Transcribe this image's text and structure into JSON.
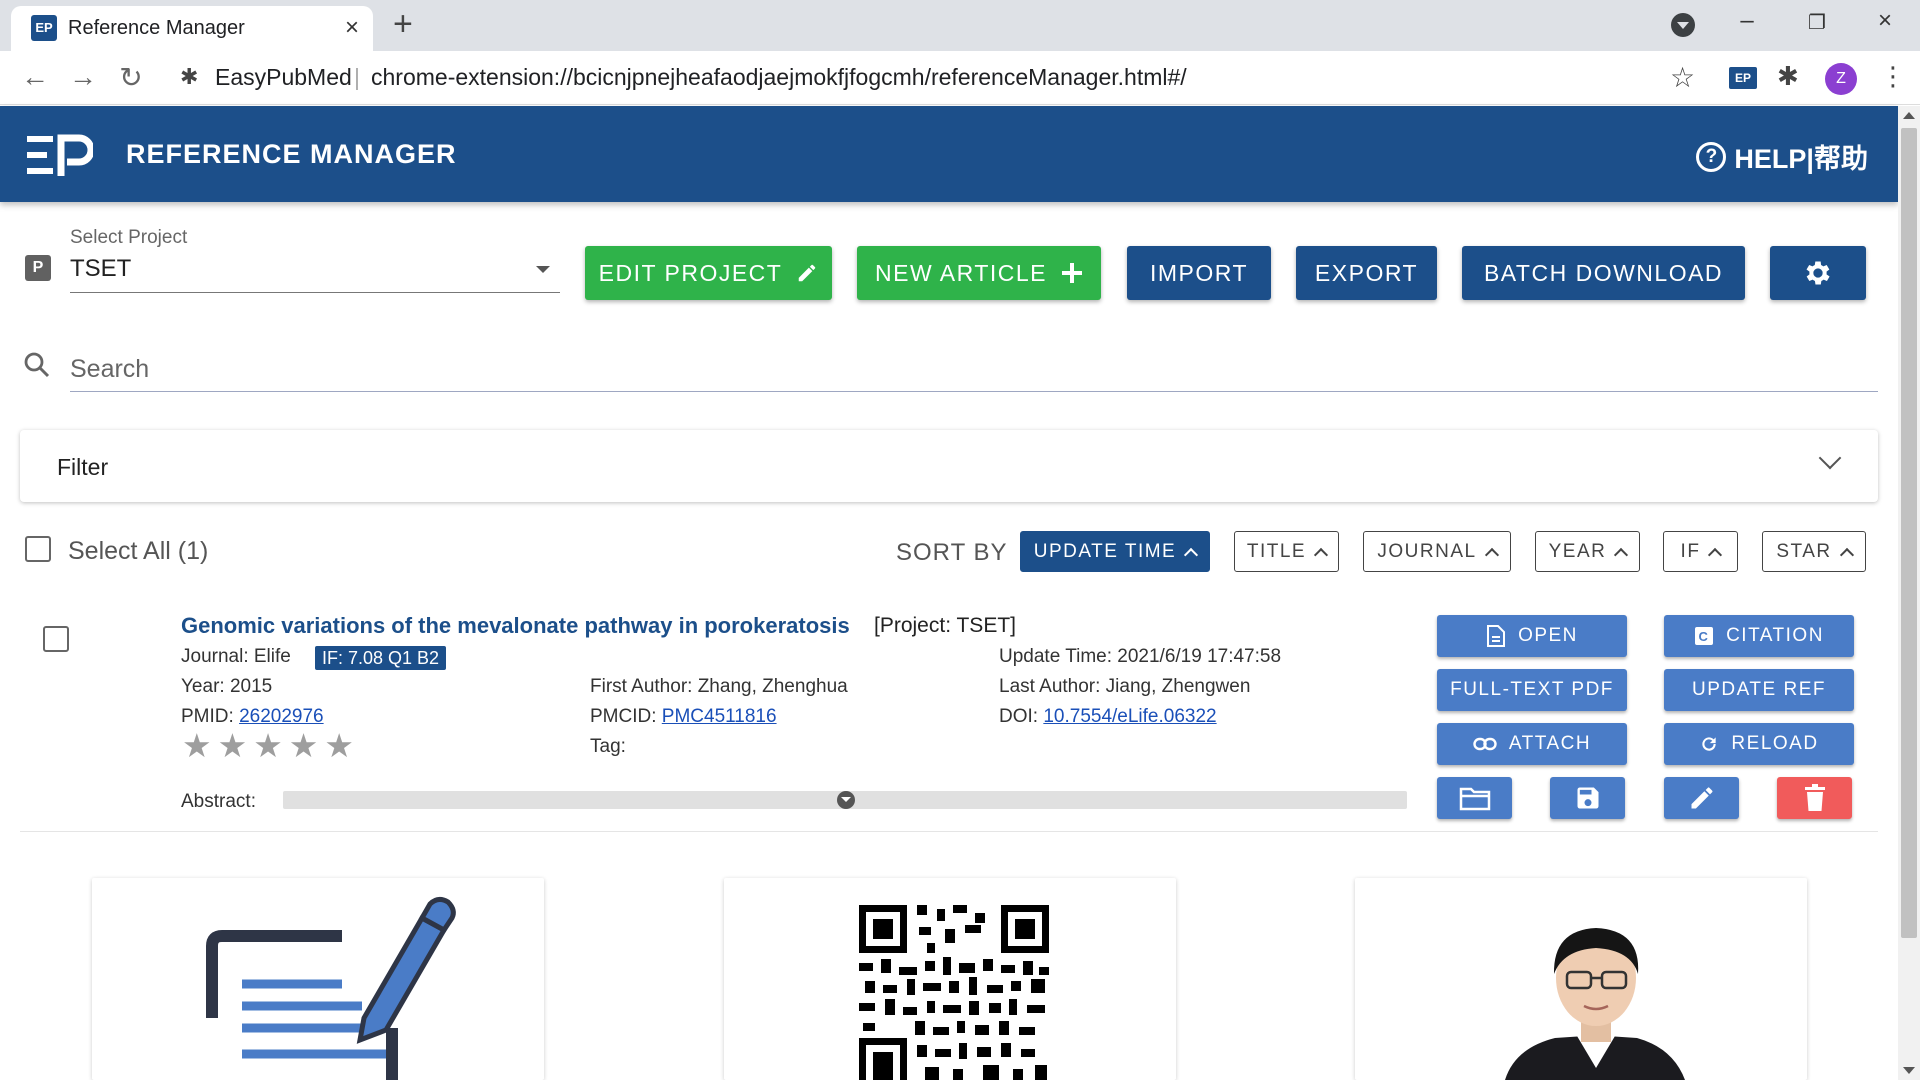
{
  "browser": {
    "tab_title": "Reference Manager",
    "tab_favicon": "EP",
    "tab_close": "×",
    "new_tab": "+",
    "window_minimize": "–",
    "window_restore": "❐",
    "window_close": "×",
    "back": "←",
    "forward": "→",
    "reload": "↻",
    "extension_name": "EasyPubMed",
    "separator": "|",
    "url": "chrome-extension://bcicnjpnejheafaodjaejmokfjfogcmh/referenceManager.html#/",
    "bookmark_star": "☆",
    "ext_badge": "EP",
    "profile_initial": "Z",
    "menu": "⋮"
  },
  "header": {
    "title": "REFERENCE MANAGER",
    "help_label": "HELP|帮助",
    "help_icon_glyph": "?"
  },
  "project": {
    "icon_letter": "P",
    "select_label": "Select Project",
    "selected": "TSET"
  },
  "actions": {
    "edit_project": "EDIT PROJECT",
    "new_article": "NEW ARTICLE",
    "import": "IMPORT",
    "export": "EXPORT",
    "batch_download": "BATCH DOWNLOAD"
  },
  "search": {
    "placeholder": "Search"
  },
  "filter": {
    "label": "Filter"
  },
  "list": {
    "select_all": "Select All (1)",
    "sort_by": "SORT BY",
    "sort_options": [
      "UPDATE TIME",
      "TITLE",
      "JOURNAL",
      "YEAR",
      "IF",
      "STAR"
    ],
    "active_sort": "UPDATE TIME"
  },
  "article": {
    "title": "Genomic variations of the mevalonate pathway in porokeratosis",
    "project_tag": "[Project: TSET]",
    "journal": "Journal: Elife",
    "if_badge": "IF: 7.08 Q1 B2",
    "year": "Year: 2015",
    "pmid_label": "PMID: ",
    "pmid": "26202976",
    "first_author": "First Author: Zhang, Zhenghua",
    "pmcid_label": "PMCID: ",
    "pmcid": "PMC4511816",
    "tag_label": "Tag:",
    "update_time": "Update Time: 2021/6/19 17:47:58",
    "last_author": "Last Author: Jiang, Zhengwen",
    "doi_label": "DOI: ",
    "doi": "10.7554/eLife.06322",
    "star_rating": 0,
    "star_max": 5,
    "abstract_label": "Abstract:",
    "buttons": {
      "open": "OPEN",
      "citation": "CITATION",
      "fulltext_pdf": "FULL-TEXT PDF",
      "update_ref": "UPDATE REF",
      "attach": "ATTACH",
      "reload": "RELOAD"
    }
  },
  "colors": {
    "primary": "#1c4f8a",
    "green": "#2fb34a",
    "article_button": "#4a7cc7",
    "delete": "#f15b5b"
  }
}
